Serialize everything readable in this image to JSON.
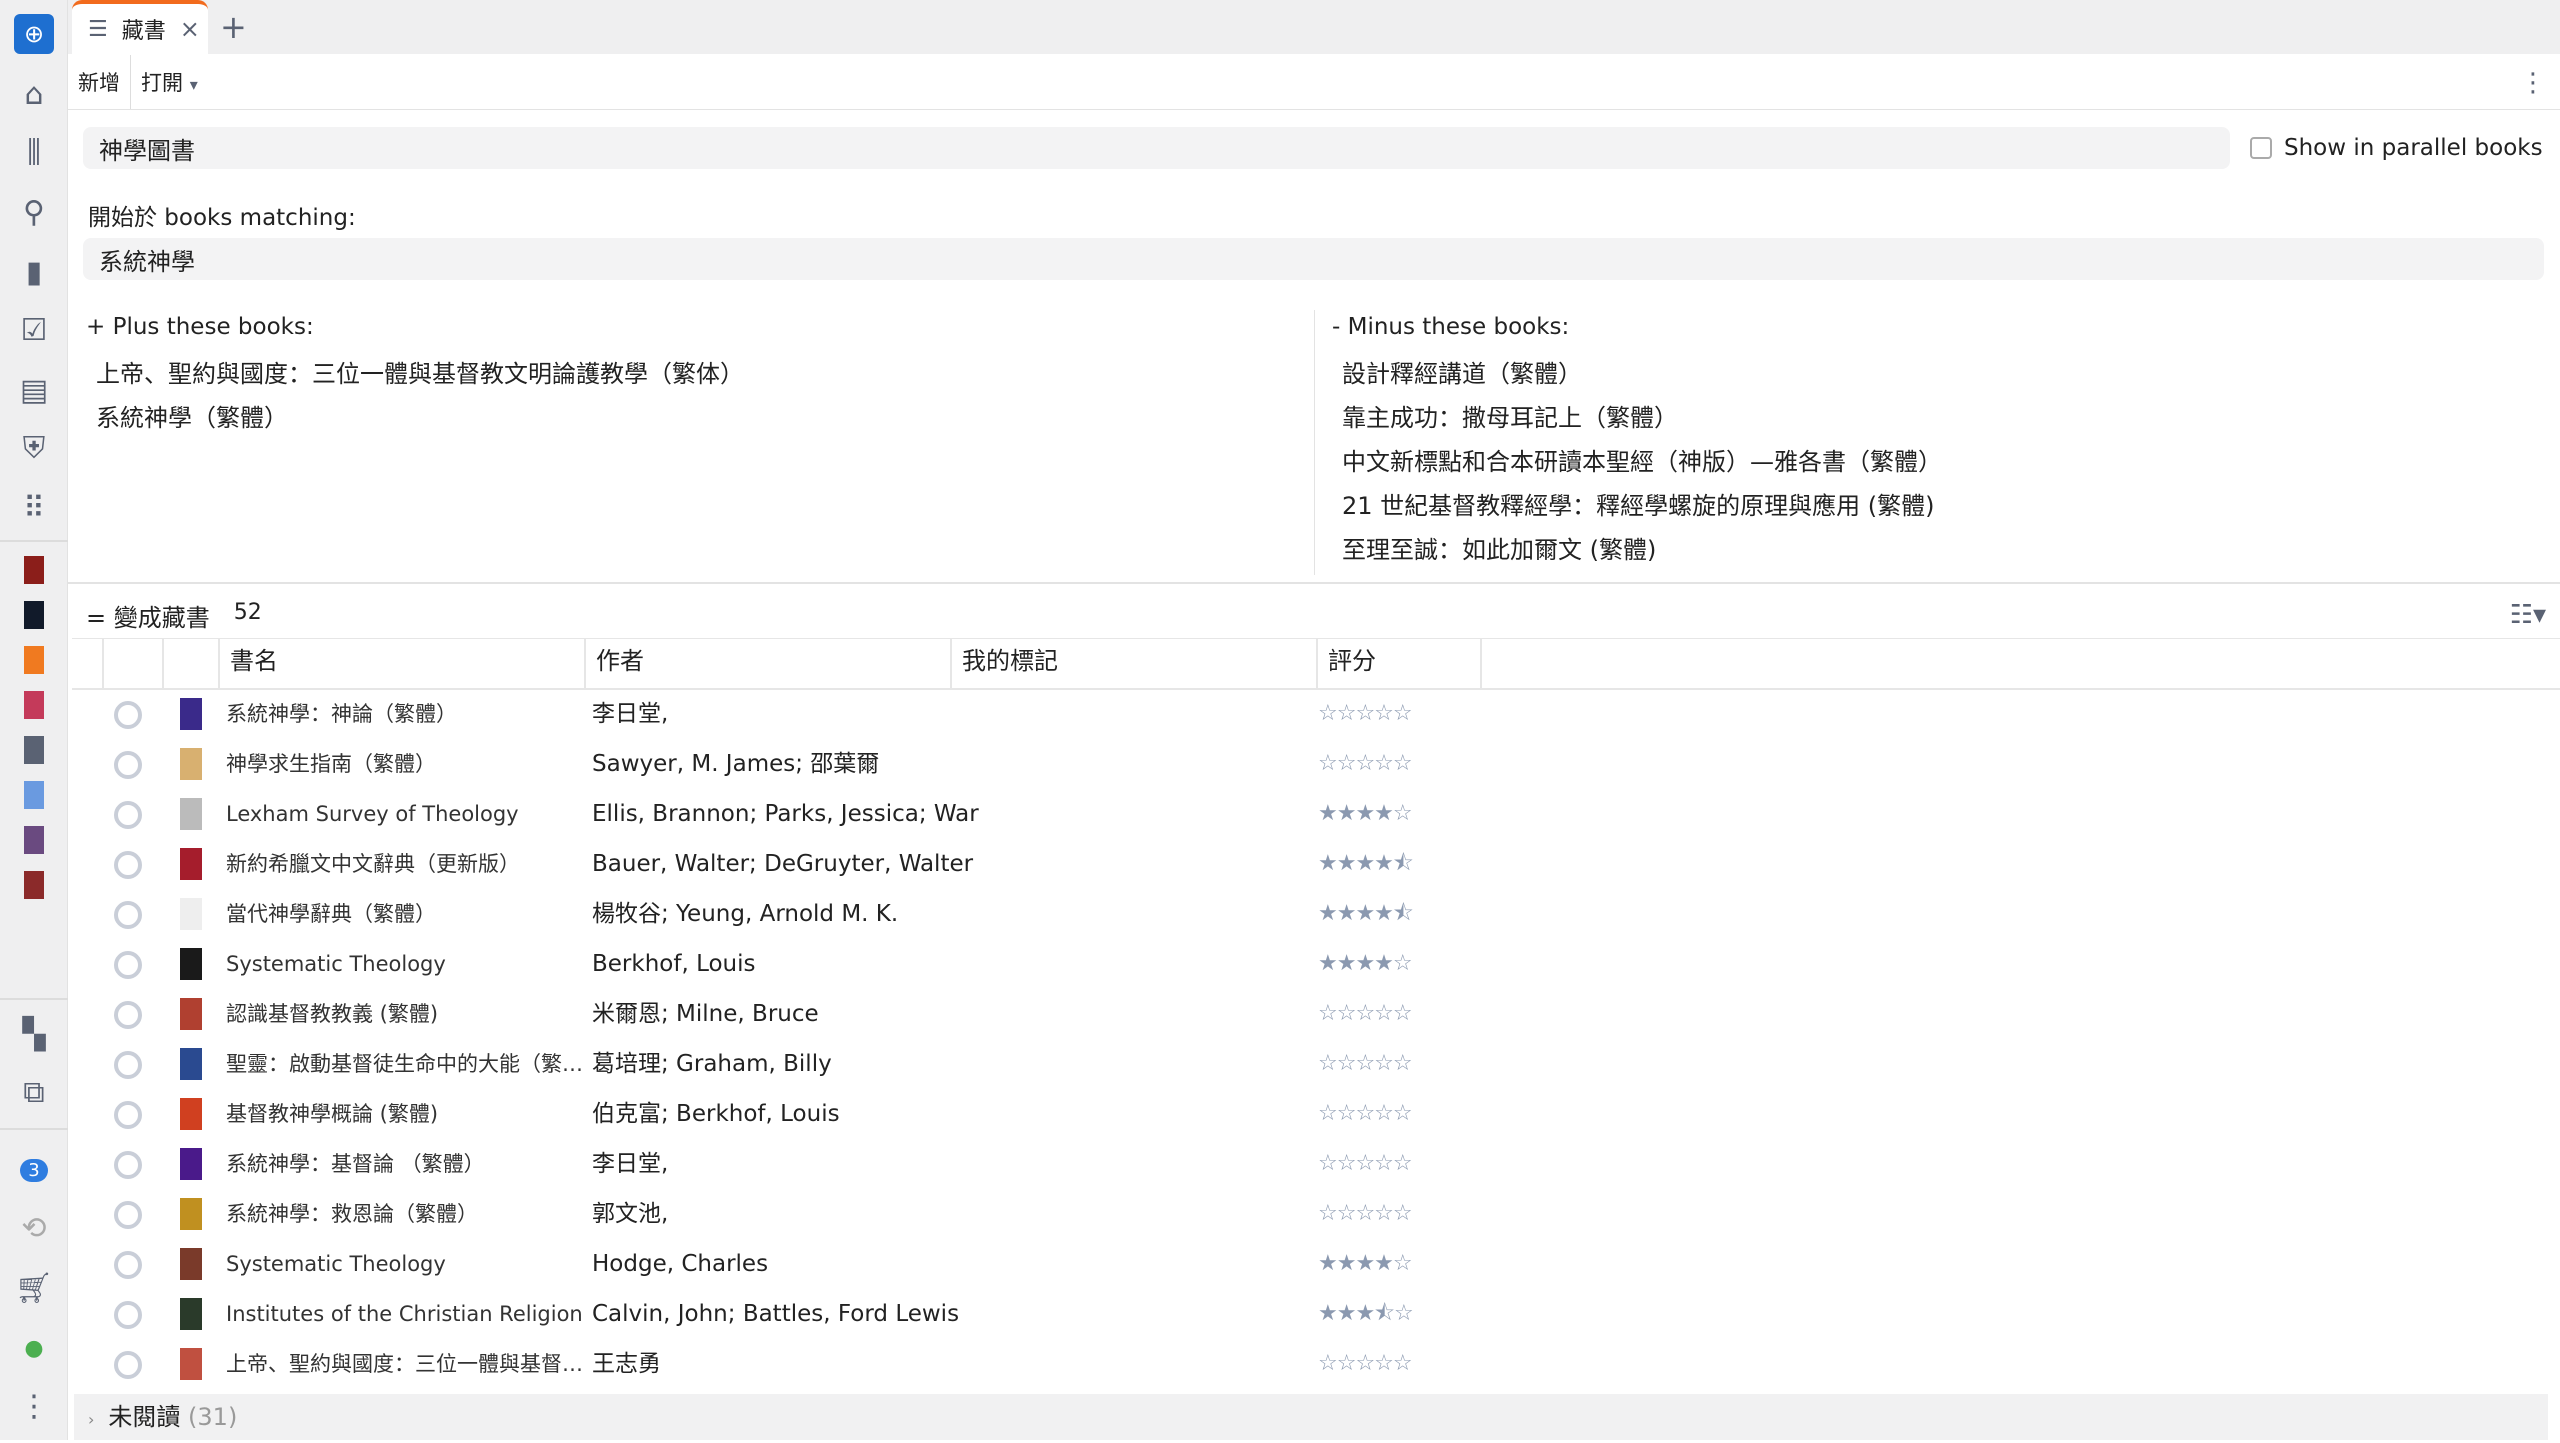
{
  "sidebar": {
    "notification_count": "3",
    "icons": [
      "logos-app-icon",
      "home-icon",
      "library-icon",
      "search-icon",
      "add-note-icon",
      "checklist-icon",
      "document-icon",
      "shield-icon",
      "apps-icon",
      "layout-icon",
      "close-panels-icon",
      "notification-badge",
      "sync-icon",
      "cart-icon",
      "user-icon",
      "more-icon"
    ],
    "recent_book_colors": [
      "#8b1e1a",
      "#111a2a",
      "#f07a20",
      "#c43a5a",
      "#5a6273",
      "#6a9ae0",
      "#6a4a80",
      "#8b2a2a"
    ]
  },
  "tab": {
    "label": "藏書",
    "close": "×",
    "new_tab": "+"
  },
  "toolbar": {
    "new": "新增",
    "open": "打開",
    "open_arrow": "▾",
    "more": "⋮"
  },
  "collection_name": "神學圖書",
  "parallel": {
    "label": "Show in parallel books",
    "checked": false
  },
  "start_label": "開始於 books matching:",
  "start_query": "系統神學",
  "plus": {
    "label": "+ Plus these books:",
    "books": [
      "上帝、聖約與國度：三位一體與基督教文明論護教學（繁体）",
      "系統神學（繁體）"
    ]
  },
  "minus": {
    "label": "-  Minus these books:",
    "books": [
      "設計釋經講道（繁體）",
      "靠主成功：撒母耳記上（繁體）",
      "中文新標點和合本研讀本聖經（神版）—雅各書（繁體）",
      "21 世紀基督教釋經學：釋經學螺旋的原理與應用 (繁體)",
      "至理至誠：如此加爾文 (繁體)"
    ]
  },
  "result": {
    "label": "= 變成藏書",
    "count": "52",
    "view_icon": "☷▾"
  },
  "columns": [
    "書名",
    "作者",
    "我的標記",
    "評分"
  ],
  "books": [
    {
      "title": "系統神學：神論（繁體）",
      "author": "李日堂,",
      "rating": 0,
      "cover": "#3a2a8a"
    },
    {
      "title": "神學求生指南（繁體）",
      "author": "Sawyer, M. James; 邵葉爾",
      "rating": 0,
      "cover": "#d8b070"
    },
    {
      "title": "Lexham Survey of Theology",
      "author": "Ellis, Brannon; Parks, Jessica; War",
      "rating": 4,
      "cover": "#bbbbbb"
    },
    {
      "title": "新約希臘文中文辭典（更新版）",
      "author": "Bauer, Walter; DeGruyter, Walter",
      "rating": 4.5,
      "cover": "#a51d2c"
    },
    {
      "title": "當代神學辭典（繁體）",
      "author": "楊牧谷; Yeung, Arnold M. K.",
      "rating": 4.5,
      "cover": "#eeeeee"
    },
    {
      "title": "Systematic Theology",
      "author": "Berkhof, Louis",
      "rating": 4,
      "cover": "#1a1a1a"
    },
    {
      "title": "認識基督教教義 (繁體)",
      "author": "米爾恩; Milne, Bruce",
      "rating": 0,
      "cover": "#b04030"
    },
    {
      "title": "聖靈：啟動基督徒生命中的大能（繁體）",
      "author": "葛培理; Graham, Billy",
      "rating": 0,
      "cover": "#2a4a90"
    },
    {
      "title": "基督教神學概論 (繁體)",
      "author": "伯克富; Berkhof, Louis",
      "rating": 0,
      "cover": "#d04020"
    },
    {
      "title": "系統神學：基督論 （繁體）",
      "author": "李日堂,",
      "rating": 0,
      "cover": "#4a1a8a"
    },
    {
      "title": "系統神學：救恩論（繁體）",
      "author": "郭文池,",
      "rating": 0,
      "cover": "#c09020"
    },
    {
      "title": "Systematic Theology",
      "author": "Hodge, Charles",
      "rating": 4,
      "cover": "#7a3a2a"
    },
    {
      "title": "Institutes of the Christian Religion",
      "author": "Calvin, John; Battles, Ford Lewis",
      "rating": 3.5,
      "cover": "#2a3a2a"
    },
    {
      "title": "上帝、聖約與國度：三位一體與基督教文明論護教學（繁体）",
      "author": "王志勇",
      "rating": 0,
      "cover": "#c05040"
    }
  ],
  "unread": {
    "label": "未閱讀",
    "count": "(31)"
  }
}
